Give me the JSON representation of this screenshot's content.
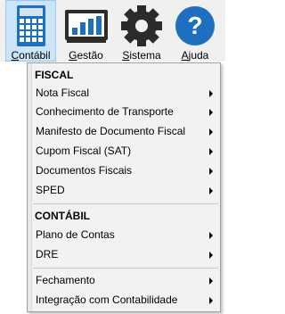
{
  "toolbar": {
    "buttons": [
      {
        "name": "contabil",
        "label_mnemonic": "C",
        "label_rest": "ontábil",
        "icon": "calculator-icon",
        "active": true
      },
      {
        "name": "gestao",
        "label_mnemonic": "G",
        "label_rest": "estão",
        "icon": "chart-monitor-icon",
        "active": false
      },
      {
        "name": "sistema",
        "label_mnemonic": "S",
        "label_rest": "istema",
        "icon": "gear-icon",
        "active": false
      },
      {
        "name": "ajuda",
        "label_mnemonic": "A",
        "label_rest": "juda",
        "icon": "help-icon",
        "active": false
      }
    ],
    "help_glyph": "?"
  },
  "menu": {
    "section1": "FISCAL",
    "items1": [
      "Nota Fiscal",
      "Conhecimento de Transporte",
      "Manifesto de Documento Fiscal",
      "Cupom Fiscal (SAT)",
      "Documentos Fiscais",
      "SPED"
    ],
    "section2": "CONTÁBIL",
    "items2": [
      "Plano de Contas",
      "DRE"
    ],
    "items3": [
      "Fechamento",
      "Integração com Contabilidade"
    ]
  },
  "colors": {
    "accent_blue": "#1e6fbf",
    "active_bg": "#cce4f7",
    "gear_dark": "#2b2b2b"
  }
}
